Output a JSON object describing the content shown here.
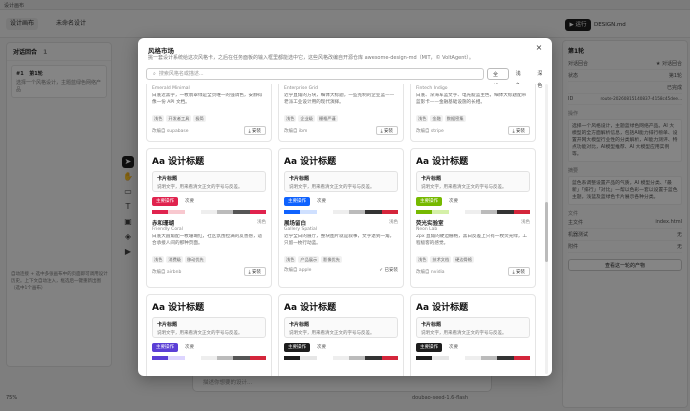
{
  "app": {
    "title": "设计画布"
  },
  "topbar": {
    "tabs": [
      "设计画布",
      "未命名设计"
    ],
    "run_label": "▶ 运行",
    "file_label": "DESIGN.md"
  },
  "left_panel": {
    "title": "对话回合",
    "count": "1",
    "item_tag": "#1",
    "item_title": "第1轮",
    "item_text": "选择一个风格设计，主题蓝绿色网络产品",
    "note": "自动连接 + 选中多张画布中的页面即可调用设计历史。上下文自动注入，框选后一键重新出图（选中1个画布）"
  },
  "canvas_tools": [
    "cursor-icon",
    "hand-icon",
    "frame-icon",
    "text-icon",
    "image-icon",
    "layers-icon",
    "play-icon"
  ],
  "zoom": {
    "label": "75%"
  },
  "chat": {
    "placeholder": "描述你想要的设计...",
    "model": "doubao-seed-1.6-flash"
  },
  "right_panel": {
    "title": "第1轮",
    "label": "第1轮",
    "rows": [
      {
        "k": "对话回合",
        "v": "★ 对话回合"
      },
      {
        "k": "状态",
        "v": "第1轮"
      },
      {
        "k": "",
        "v": "已完成"
      },
      {
        "k": "ID",
        "v": "route-20260815140837-4158c45dee..."
      }
    ],
    "sec1": "操作",
    "text1": "选择一个风格设计，主题蓝绿色网络产品。AI 大模型的全方面解析信息，包括AI能力排行榜单、设置开网大模型行业性的分类解析，AI能力测评、特点功能对比，AI模型推荐、AI 大模型应用实例等。",
    "sec2": "摘要",
    "text2": "蓝色系调整设置产品的气质，AI 模型分类、「最新」「排行」「对比」一帮以色彩一套以设置于蓝色主题，浅蓝及蓝绿色卡片展示各种分类。",
    "sec3": "文件",
    "files": [
      {
        "k": "主文件",
        "v": "index.html"
      },
      {
        "k": "机器测试",
        "v": "无"
      },
      {
        "k": "附件",
        "v": "无"
      }
    ],
    "button": "查看这一轮的产物"
  },
  "modal": {
    "title": "风格市场",
    "subtitle": "挑一套设计系统给这次风格卡，之后在任务面板的输入框里都能选中它，这些风格改编自开源仓库 awesome-design-md（MIT，© VoltAgent）。",
    "search_placeholder": "搜索风格名或描述...",
    "filters": [
      "全部",
      "浅色",
      "深色"
    ],
    "install_label": "安装",
    "installed_label": "已安装",
    "top_cards": [
      {
        "name": "Emerald Minimal",
        "desc": "白底近黑字，一枚翡翠绿是全页唯一的强调色，安静得像一份 API 文档。",
        "tags": [
          "浅色",
          "开发者工具",
          "极简"
        ],
        "source": "改编自 supabase",
        "installed": false
      },
      {
        "name": "Enterprise Grid",
        "desc": "近乎直角的方块，细体大标题，一些克制的企业蓝——老派工业设计用的现代演绎。",
        "tags": [
          "浅色",
          "企业级",
          "栅格严谨"
        ],
        "source": "改编自 ibm",
        "installed": false
      },
      {
        "name": "Fintech Indigo",
        "desc": "白底、深海军蓝文字、电光靛蓝主色，细体大标题配带蓝影卡——金融基础设施的长相。",
        "tags": [
          "浅色",
          "金融",
          "数据密集"
        ],
        "source": "改编自 stripe",
        "installed": false
      }
    ],
    "cards": [
      {
        "heading": "Aa 设计标题",
        "card_title": "卡片标题",
        "card_desc": "说明文字，用来看清文正文的字号与反差。",
        "primary": "主要操作",
        "secondary": "次要",
        "name": "赤和珊瑚",
        "mode": "浅色",
        "en": "Friendly Coral",
        "desc": "白底大圆角配一枚珊瑚红，社区氛围拉满的友善感，适合承接人间的那种页面。",
        "tags": [
          "浅色",
          "消费级",
          "移动优先"
        ],
        "source": "改编自 airbnb",
        "installed": false
      },
      {
        "heading": "Aa 设计标题",
        "card_title": "卡片标题",
        "card_desc": "说明文字，用来看清文正文的字号与反差。",
        "primary": "主要操作",
        "secondary": "次要",
        "name": "展场留白",
        "mode": "浅色",
        "en": "Gallery Spatial",
        "desc": "近乎全白的展厅，整块图片就是叙事，文字退到一角，只留一枚行动蓝。",
        "tags": [
          "浅色",
          "产品展示",
          "影像优先"
        ],
        "source": "改编自 apple",
        "installed": true
      },
      {
        "heading": "Aa 设计标题",
        "card_title": "卡片标题",
        "card_desc": "说明文字，用来看清文正文的字号与反差。",
        "primary": "主要操作",
        "secondary": "次要",
        "name": "荧光实验室",
        "mode": "浅色",
        "en": "Neon Lab",
        "desc": "2px 直角的硬边栅格，黑白反差上只有一枚荧光绿，工程极客的感觉。",
        "tags": [
          "浅色",
          "技术文档",
          "硬边骨格"
        ],
        "source": "改编自 nvidia",
        "installed": false
      },
      {
        "heading": "Aa 设计标题",
        "card_title": "卡片标题",
        "card_desc": "说明文字，用来看清文正文的字号与反差。",
        "primary": "主要操作",
        "secondary": "次要",
        "name": "",
        "mode": "",
        "en": "",
        "desc": "",
        "tags": [],
        "source": "",
        "installed": false
      },
      {
        "heading": "Aa 设计标题",
        "card_title": "卡片标题",
        "card_desc": "说明文字，用来看清文正文的字号与反差。",
        "primary": "主要操作",
        "secondary": "次要",
        "name": "",
        "mode": "",
        "en": "",
        "desc": "",
        "tags": [],
        "source": "",
        "installed": false
      },
      {
        "heading": "Aa 设计标题",
        "card_title": "卡片标题",
        "card_desc": "说明文字，用来看清文正文的字号与反差。",
        "primary": "主要操作",
        "secondary": "次要",
        "name": "",
        "mode": "",
        "en": "",
        "desc": "",
        "tags": [],
        "source": "",
        "installed": false
      }
    ],
    "accents": [
      "#e0234e",
      "#0f62fe",
      "#76b900",
      "#5b3fd6",
      "#1d1d1d",
      "#1d1d1d"
    ],
    "swatch_sets": [
      [
        "#e0234e",
        "#f8c8cf",
        "#ffffff",
        "#eeeeee",
        "#bbbbbb",
        "#555555",
        "#e0234e"
      ],
      [
        "#0f62fe",
        "#cfe0ff",
        "#ffffff",
        "#eeeeee",
        "#bbbbbb",
        "#333333",
        "#d4263b"
      ],
      [
        "#76b900",
        "#d5f0a8",
        "#ffffff",
        "#eeeeee",
        "#bbbbbb",
        "#333333",
        "#d4263b"
      ],
      [
        "#5b3fd6",
        "#ddd5ff",
        "#ffffff",
        "#eeeeee",
        "#bbbbbb",
        "#555555",
        "#d4263b"
      ],
      [
        "#1d1d1d",
        "#e6e6e6",
        "#ffffff",
        "#eeeeee",
        "#bbbbbb",
        "#333333",
        "#d4263b"
      ],
      [
        "#1d1d1d",
        "#e6e6e6",
        "#ffffff",
        "#eeeeee",
        "#bbbbbb",
        "#333333",
        "#d4263b"
      ]
    ]
  }
}
